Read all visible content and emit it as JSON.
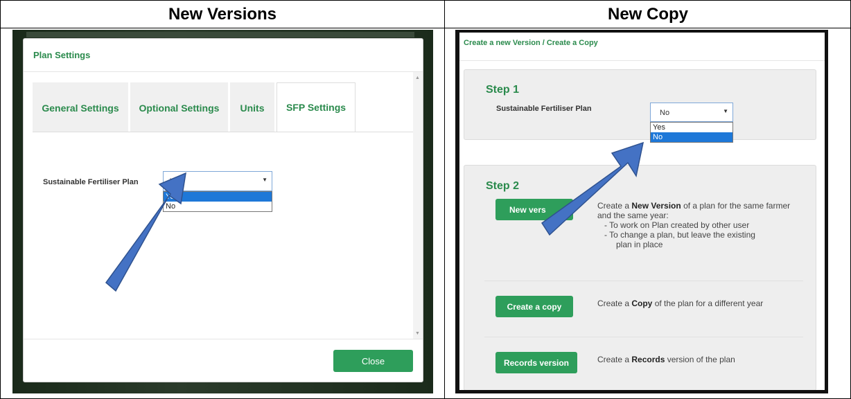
{
  "headers": {
    "left": "New Versions",
    "right": "New Copy"
  },
  "plan_settings": {
    "title": "Plan Settings",
    "tabs": [
      {
        "label": "General Settings"
      },
      {
        "label": "Optional Settings"
      },
      {
        "label": "Units"
      },
      {
        "label": "SFP Settings",
        "active": true
      }
    ],
    "sfp_label": "Sustainable Fertiliser Plan",
    "select_value": "Yes",
    "options": [
      "Yes",
      "No"
    ],
    "highlighted_option": "Yes",
    "close_label": "Close"
  },
  "create_version": {
    "title": "Create a new Version / Create a Copy",
    "step1": "Step 1",
    "sfp_label": "Sustainable Fertiliser Plan",
    "select_value": "No",
    "options": [
      "Yes",
      "No"
    ],
    "highlighted_option": "No",
    "step2": "Step 2",
    "new_version_button": "New vers",
    "new_version_desc_pre": "Create a ",
    "new_version_desc_bold": "New Version",
    "new_version_desc_post": " of a plan for the same farmer and the same year:",
    "new_version_bullet1": "- To work on Plan created by other user",
    "new_version_bullet2": "- To change a plan, but leave the existing",
    "new_version_bullet2b": "plan in place",
    "copy_button": "Create a copy",
    "copy_desc_pre": "Create a ",
    "copy_desc_bold": "Copy",
    "copy_desc_post": " of the plan for a different year",
    "records_button": "Records version",
    "records_desc_pre": "Create a ",
    "records_desc_bold": "Records",
    "records_desc_post": " version of the plan"
  },
  "colors": {
    "accent_green": "#2e9e5b",
    "title_green": "#2a8a4c",
    "arrow_blue": "#4472c4",
    "highlight_blue": "#1e78d8"
  },
  "icons": {
    "select_caret": "▼",
    "scroll_up": "▲",
    "scroll_down": "▼"
  }
}
